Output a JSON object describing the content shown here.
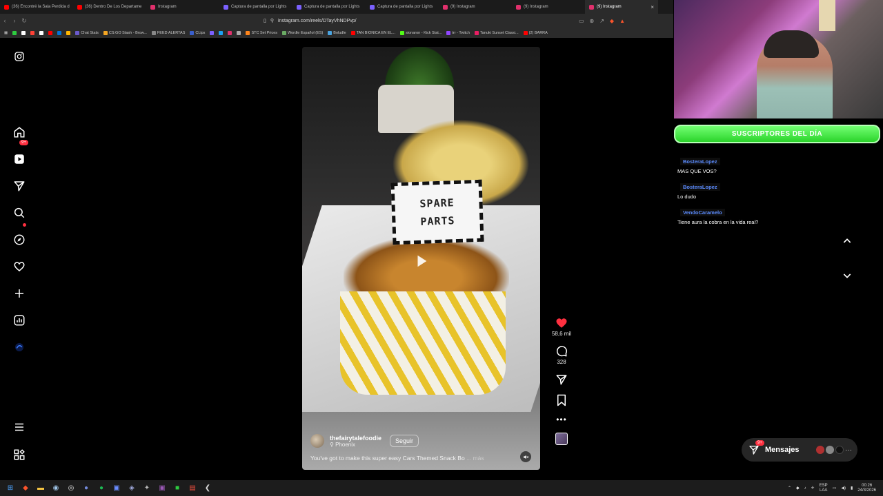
{
  "browser": {
    "tabs": [
      {
        "title": "(36) Encontré la Sala Perdida d",
        "color": "#ff0000",
        "active": false
      },
      {
        "title": "(36) Dentro De Los Departame",
        "color": "#ff0000",
        "active": false
      },
      {
        "title": "Instagram",
        "color": "#e1306c",
        "active": false
      },
      {
        "title": "Captura de pantalla por Lights",
        "color": "#7b61ff",
        "active": false
      },
      {
        "title": "Captura de pantalla por Lights",
        "color": "#7b61ff",
        "active": false
      },
      {
        "title": "Captura de pantalla por Lights",
        "color": "#7b61ff",
        "active": false
      },
      {
        "title": "(9) Instagram",
        "color": "#e1306c",
        "active": false
      },
      {
        "title": "(9) Instagram",
        "color": "#e1306c",
        "active": false
      },
      {
        "title": "(9) Instagram",
        "color": "#e1306c",
        "active": true
      }
    ],
    "url": "instagram.com/reels/DTayVhNDPvp/",
    "bookmarks": [
      {
        "label": "",
        "color": "#2ecc40"
      },
      {
        "label": "",
        "color": "#ffffff"
      },
      {
        "label": "",
        "color": "#ff4136"
      },
      {
        "label": "",
        "color": "#ffffff"
      },
      {
        "label": "",
        "color": "#ff0000"
      },
      {
        "label": "",
        "color": "#0074d9"
      },
      {
        "label": "",
        "color": "#ffb700"
      },
      {
        "label": "Chat Stats",
        "color": "#6a5acd"
      },
      {
        "label": "CS:GO Stash - Brow...",
        "color": "#f5a623"
      },
      {
        "label": "FEED ALERTAS",
        "color": "#888888"
      },
      {
        "label": "CLips",
        "color": "#3a5fcd"
      },
      {
        "label": "",
        "color": "#7b61ff"
      },
      {
        "label": "",
        "color": "#1da1f2"
      },
      {
        "label": "",
        "color": "#e1306c"
      },
      {
        "label": "",
        "color": "#aaaaaa"
      },
      {
        "label": "STC Set Prices",
        "color": "#ff851b"
      },
      {
        "label": "Wordle Español (ES)",
        "color": "#6aaa64"
      },
      {
        "label": "Boludle",
        "color": "#4aa3df"
      },
      {
        "label": "TAN BIONICA EN EL...",
        "color": "#ff0000"
      },
      {
        "label": "sionaron - Kick Stat...",
        "color": "#53fc18"
      },
      {
        "label": "trr - Twitch",
        "color": "#9146ff"
      },
      {
        "label": "Tanuki Sunset Classi...",
        "color": "#e91e63"
      },
      {
        "label": "(2) BARRA",
        "color": "#ff0000"
      }
    ]
  },
  "sidebar": {
    "notifications_badge": "9+"
  },
  "reel": {
    "sign_line1": "SPARE",
    "sign_line2": "PARTS",
    "username": "thefairytalefoodie",
    "location": "Phoenix",
    "follow_label": "Seguir",
    "caption": "You've got to make this super easy Cars Themed Snack Bo",
    "more_label": "... más",
    "likes": "58,6 mil",
    "comments": "328"
  },
  "messages": {
    "label": "Mensajes",
    "badge": "9+"
  },
  "stream_overlay": {
    "banner": "SUSCRIPTORES DEL DÍA",
    "chat": [
      {
        "user": "BosteraLopez",
        "text": "MAS QUE VOS?"
      },
      {
        "user": "BosteraLopez",
        "text": "Lo dudo"
      },
      {
        "user": "VendoCaramelo",
        "text": "Tiene aura la cobra en la vida real?"
      }
    ]
  },
  "taskbar": {
    "lang_top": "ESP",
    "lang_bottom": "LAA",
    "time": "00:26",
    "date": "24/3/2026"
  }
}
